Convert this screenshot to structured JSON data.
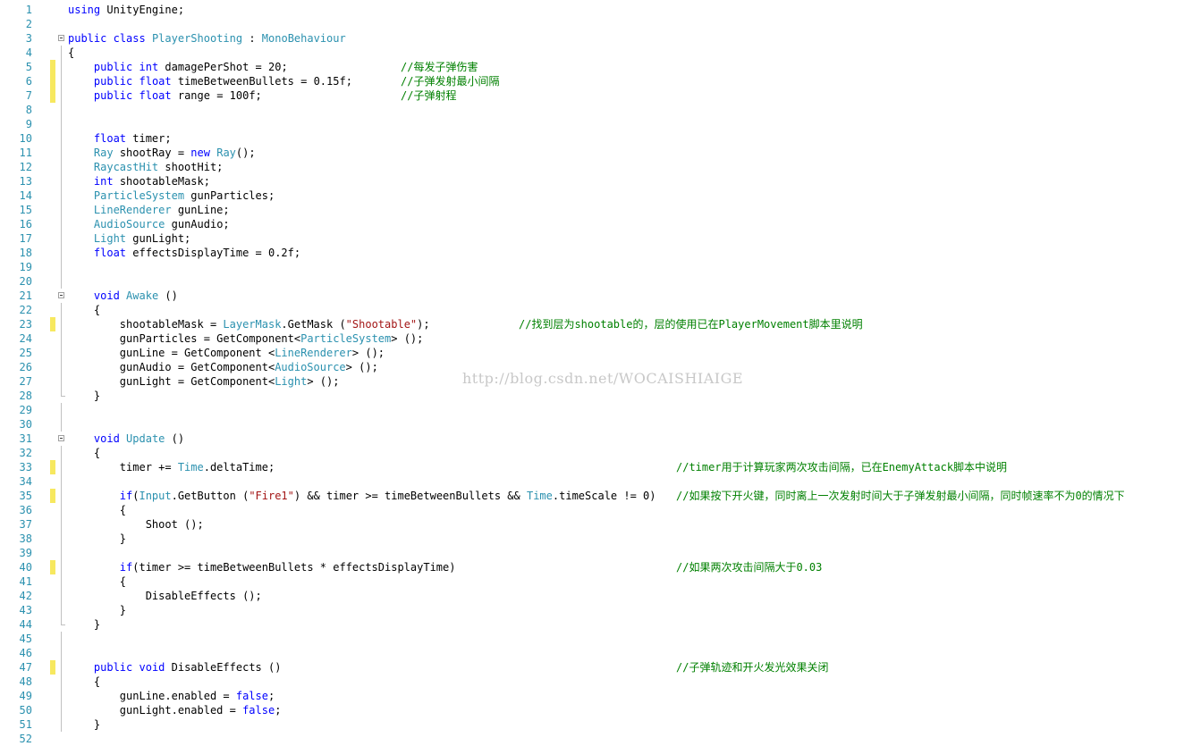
{
  "editor": {
    "language": "C#",
    "watermark": "http://blog.csdn.net/WOCAISHIAIGE",
    "colors": {
      "keyword": "#0000ff",
      "type": "#2b91af",
      "string": "#a31515",
      "comment": "#008000",
      "line_number": "#2b91af",
      "change_marker": "#f7e85f"
    },
    "line_numbers": [
      "1",
      "2",
      "3",
      "4",
      "5",
      "6",
      "7",
      "8",
      "9",
      "10",
      "11",
      "12",
      "13",
      "14",
      "15",
      "16",
      "17",
      "18",
      "19",
      "20",
      "21",
      "22",
      "23",
      "24",
      "25",
      "26",
      "27",
      "28",
      "29",
      "30",
      "31",
      "32",
      "33",
      "34",
      "35",
      "36",
      "37",
      "38",
      "39",
      "40",
      "41",
      "42",
      "43",
      "44",
      "45",
      "46",
      "47",
      "48",
      "49",
      "50",
      "51",
      "52"
    ],
    "lines": [
      {
        "tokens": [
          {
            "t": "kw",
            "v": "using"
          },
          {
            "t": "p",
            "v": " UnityEngine;"
          }
        ]
      },
      {
        "tokens": []
      },
      {
        "tokens": [
          {
            "t": "kw",
            "v": "public"
          },
          {
            "t": "p",
            "v": " "
          },
          {
            "t": "kw",
            "v": "class"
          },
          {
            "t": "p",
            "v": " "
          },
          {
            "t": "ty",
            "v": "PlayerShooting"
          },
          {
            "t": "p",
            "v": " : "
          },
          {
            "t": "ty",
            "v": "MonoBehaviour"
          }
        ]
      },
      {
        "tokens": [
          {
            "t": "p",
            "v": "{"
          }
        ]
      },
      {
        "tokens": [
          {
            "t": "p",
            "v": "    "
          },
          {
            "t": "kw",
            "v": "public"
          },
          {
            "t": "p",
            "v": " "
          },
          {
            "t": "kw",
            "v": "int"
          },
          {
            "t": "p",
            "v": " damagePerShot = 20;"
          }
        ],
        "comment": "//每发子弹伤害"
      },
      {
        "tokens": [
          {
            "t": "p",
            "v": "    "
          },
          {
            "t": "kw",
            "v": "public"
          },
          {
            "t": "p",
            "v": " "
          },
          {
            "t": "kw",
            "v": "float"
          },
          {
            "t": "p",
            "v": " timeBetweenBullets = 0.15f;"
          }
        ],
        "comment": "//子弹发射最小间隔"
      },
      {
        "tokens": [
          {
            "t": "p",
            "v": "    "
          },
          {
            "t": "kw",
            "v": "public"
          },
          {
            "t": "p",
            "v": " "
          },
          {
            "t": "kw",
            "v": "float"
          },
          {
            "t": "p",
            "v": " range = 100f;"
          }
        ],
        "comment": "//子弹射程"
      },
      {
        "tokens": []
      },
      {
        "tokens": []
      },
      {
        "tokens": [
          {
            "t": "p",
            "v": "    "
          },
          {
            "t": "kw",
            "v": "float"
          },
          {
            "t": "p",
            "v": " timer;"
          }
        ]
      },
      {
        "tokens": [
          {
            "t": "p",
            "v": "    "
          },
          {
            "t": "ty",
            "v": "Ray"
          },
          {
            "t": "p",
            "v": " shootRay = "
          },
          {
            "t": "kw",
            "v": "new"
          },
          {
            "t": "p",
            "v": " "
          },
          {
            "t": "ty",
            "v": "Ray"
          },
          {
            "t": "p",
            "v": "();"
          }
        ]
      },
      {
        "tokens": [
          {
            "t": "p",
            "v": "    "
          },
          {
            "t": "ty",
            "v": "RaycastHit"
          },
          {
            "t": "p",
            "v": " shootHit;"
          }
        ]
      },
      {
        "tokens": [
          {
            "t": "p",
            "v": "    "
          },
          {
            "t": "kw",
            "v": "int"
          },
          {
            "t": "p",
            "v": " shootableMask;"
          }
        ]
      },
      {
        "tokens": [
          {
            "t": "p",
            "v": "    "
          },
          {
            "t": "ty",
            "v": "ParticleSystem"
          },
          {
            "t": "p",
            "v": " gunParticles;"
          }
        ]
      },
      {
        "tokens": [
          {
            "t": "p",
            "v": "    "
          },
          {
            "t": "ty",
            "v": "LineRenderer"
          },
          {
            "t": "p",
            "v": " gunLine;"
          }
        ]
      },
      {
        "tokens": [
          {
            "t": "p",
            "v": "    "
          },
          {
            "t": "ty",
            "v": "AudioSource"
          },
          {
            "t": "p",
            "v": " gunAudio;"
          }
        ]
      },
      {
        "tokens": [
          {
            "t": "p",
            "v": "    "
          },
          {
            "t": "ty",
            "v": "Light"
          },
          {
            "t": "p",
            "v": " gunLight;"
          }
        ]
      },
      {
        "tokens": [
          {
            "t": "p",
            "v": "    "
          },
          {
            "t": "kw",
            "v": "float"
          },
          {
            "t": "p",
            "v": " effectsDisplayTime = 0.2f;"
          }
        ]
      },
      {
        "tokens": []
      },
      {
        "tokens": []
      },
      {
        "tokens": [
          {
            "t": "p",
            "v": "    "
          },
          {
            "t": "kw",
            "v": "void"
          },
          {
            "t": "p",
            "v": " "
          },
          {
            "t": "ty",
            "v": "Awake"
          },
          {
            "t": "p",
            "v": " ()"
          }
        ]
      },
      {
        "tokens": [
          {
            "t": "p",
            "v": "    {"
          }
        ]
      },
      {
        "tokens": [
          {
            "t": "p",
            "v": "        shootableMask = "
          },
          {
            "t": "ty",
            "v": "LayerMask"
          },
          {
            "t": "p",
            "v": ".GetMask ("
          },
          {
            "t": "st",
            "v": "\"Shootable\""
          },
          {
            "t": "p",
            "v": ");"
          }
        ],
        "comment": "//找到层为shootable的，层的使用已在PlayerMovement脚本里说明"
      },
      {
        "tokens": [
          {
            "t": "p",
            "v": "        gunParticles = GetComponent<"
          },
          {
            "t": "ty",
            "v": "ParticleSystem"
          },
          {
            "t": "p",
            "v": "> ();"
          }
        ]
      },
      {
        "tokens": [
          {
            "t": "p",
            "v": "        gunLine = GetComponent <"
          },
          {
            "t": "ty",
            "v": "LineRenderer"
          },
          {
            "t": "p",
            "v": "> ();"
          }
        ]
      },
      {
        "tokens": [
          {
            "t": "p",
            "v": "        gunAudio = GetComponent<"
          },
          {
            "t": "ty",
            "v": "AudioSource"
          },
          {
            "t": "p",
            "v": "> ();"
          }
        ]
      },
      {
        "tokens": [
          {
            "t": "p",
            "v": "        gunLight = GetComponent<"
          },
          {
            "t": "ty",
            "v": "Light"
          },
          {
            "t": "p",
            "v": "> ();"
          }
        ]
      },
      {
        "tokens": [
          {
            "t": "p",
            "v": "    }"
          }
        ]
      },
      {
        "tokens": []
      },
      {
        "tokens": []
      },
      {
        "tokens": [
          {
            "t": "p",
            "v": "    "
          },
          {
            "t": "kw",
            "v": "void"
          },
          {
            "t": "p",
            "v": " "
          },
          {
            "t": "ty",
            "v": "Update"
          },
          {
            "t": "p",
            "v": " ()"
          }
        ]
      },
      {
        "tokens": [
          {
            "t": "p",
            "v": "    {"
          }
        ]
      },
      {
        "tokens": [
          {
            "t": "p",
            "v": "        timer += "
          },
          {
            "t": "ty",
            "v": "Time"
          },
          {
            "t": "p",
            "v": ".deltaTime;"
          }
        ],
        "comment": "//timer用于计算玩家两次攻击间隔，已在EnemyAttack脚本中说明"
      },
      {
        "tokens": []
      },
      {
        "tokens": [
          {
            "t": "p",
            "v": "        "
          },
          {
            "t": "kw",
            "v": "if"
          },
          {
            "t": "p",
            "v": "("
          },
          {
            "t": "ty",
            "v": "Input"
          },
          {
            "t": "p",
            "v": ".GetButton ("
          },
          {
            "t": "st",
            "v": "\"Fire1\""
          },
          {
            "t": "p",
            "v": ") && timer >= timeBetweenBullets && "
          },
          {
            "t": "ty",
            "v": "Time"
          },
          {
            "t": "p",
            "v": ".timeScale != 0)"
          }
        ],
        "comment": "//如果按下开火键，同时离上一次发射时间大于子弹发射最小间隔，同时帧速率不为0的情况下"
      },
      {
        "tokens": [
          {
            "t": "p",
            "v": "        {"
          }
        ]
      },
      {
        "tokens": [
          {
            "t": "p",
            "v": "            Shoot ();"
          }
        ]
      },
      {
        "tokens": [
          {
            "t": "p",
            "v": "        }"
          }
        ]
      },
      {
        "tokens": []
      },
      {
        "tokens": [
          {
            "t": "p",
            "v": "        "
          },
          {
            "t": "kw",
            "v": "if"
          },
          {
            "t": "p",
            "v": "(timer >= timeBetweenBullets * effectsDisplayTime)"
          }
        ],
        "comment": "//如果两次攻击间隔大于0.03"
      },
      {
        "tokens": [
          {
            "t": "p",
            "v": "        {"
          }
        ]
      },
      {
        "tokens": [
          {
            "t": "p",
            "v": "            DisableEffects ();"
          }
        ]
      },
      {
        "tokens": [
          {
            "t": "p",
            "v": "        }"
          }
        ]
      },
      {
        "tokens": [
          {
            "t": "p",
            "v": "    }"
          }
        ]
      },
      {
        "tokens": []
      },
      {
        "tokens": []
      },
      {
        "tokens": [
          {
            "t": "p",
            "v": "    "
          },
          {
            "t": "kw",
            "v": "public"
          },
          {
            "t": "p",
            "v": " "
          },
          {
            "t": "kw",
            "v": "void"
          },
          {
            "t": "p",
            "v": " DisableEffects ()"
          }
        ],
        "comment": "//子弹轨迹和开火发光效果关闭"
      },
      {
        "tokens": [
          {
            "t": "p",
            "v": "    {"
          }
        ]
      },
      {
        "tokens": [
          {
            "t": "p",
            "v": "        gunLine.enabled = "
          },
          {
            "t": "kw",
            "v": "false"
          },
          {
            "t": "p",
            "v": ";"
          }
        ]
      },
      {
        "tokens": [
          {
            "t": "p",
            "v": "        gunLight.enabled = "
          },
          {
            "t": "kw",
            "v": "false"
          },
          {
            "t": "p",
            "v": ";"
          }
        ]
      },
      {
        "tokens": [
          {
            "t": "p",
            "v": "    }"
          }
        ]
      },
      {
        "tokens": []
      }
    ]
  }
}
